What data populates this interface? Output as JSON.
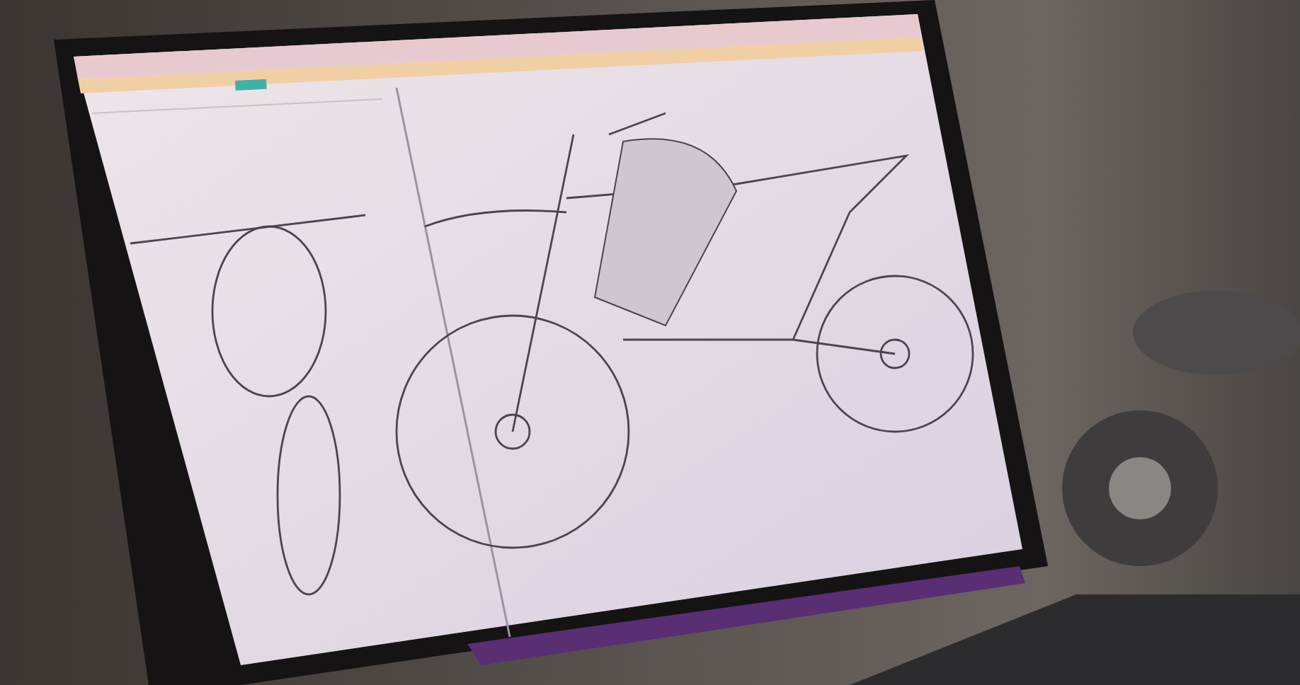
{
  "scene": {
    "kind": "photo"
  }
}
